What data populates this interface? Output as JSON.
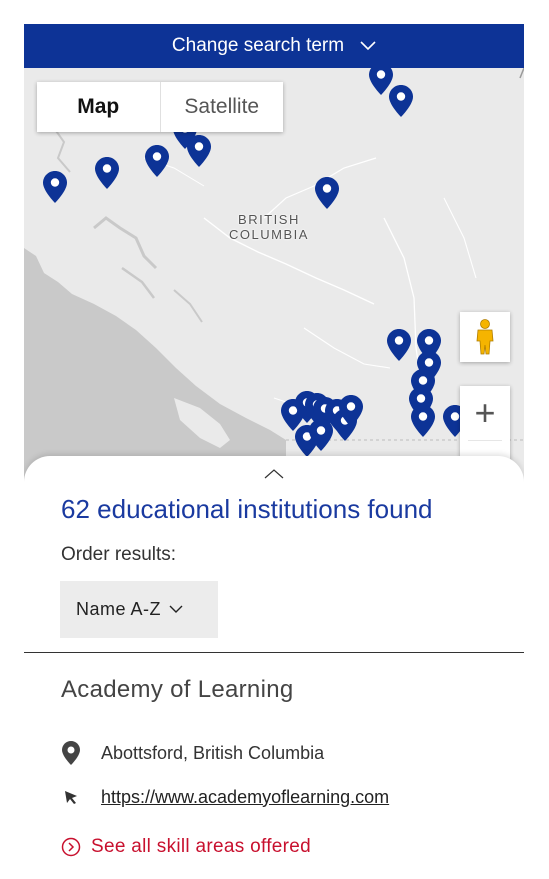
{
  "topbar": {
    "label": "Change search term"
  },
  "map": {
    "toggle": {
      "map_label": "Map",
      "satellite_label": "Satellite",
      "active": "map"
    },
    "region_label_line1": "BRITISH",
    "region_label_line2": "COLUMBIA",
    "zoom": {
      "in_label": "+",
      "out_label": "−"
    },
    "pin_color": "#0d3396",
    "land_color": "#eaeaea",
    "water_color": "#c9c9c9",
    "pin_icon": "map-pin-icon",
    "street_view_icon": "pegman-icon"
  },
  "results": {
    "count_text": "62 educational institutions found",
    "order_label": "Order results:",
    "sort_value": "Name A-Z"
  },
  "institution": {
    "name": "Academy of Learning",
    "location": "Abottsford, British Columbia",
    "url": "https://www.academyoflearning.com",
    "skills_link": "See all skill areas offered"
  },
  "colors": {
    "brand_blue": "#0d3396",
    "count_blue": "#1a3aa0",
    "link_red": "#c8102e"
  }
}
